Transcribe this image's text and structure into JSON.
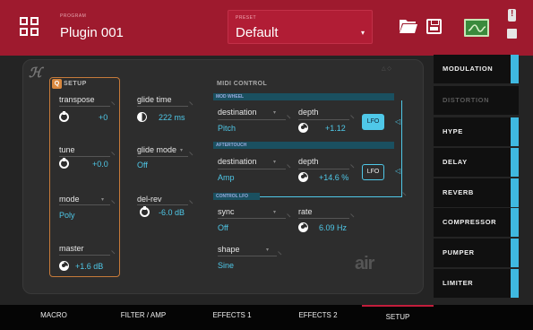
{
  "header": {
    "program_label": "PROGRAM",
    "program_name": "Plugin 001",
    "preset_label": "PRESET",
    "preset_value": "Default"
  },
  "setup": {
    "title": "SETUP",
    "badge": "Q",
    "transpose": {
      "label": "transpose",
      "value": "+0"
    },
    "tune": {
      "label": "tune",
      "value": "+0.0"
    },
    "mode": {
      "label": "mode",
      "value": "Poly"
    },
    "master": {
      "label": "master",
      "value": "+1.6 dB"
    },
    "glide_time": {
      "label": "glide time",
      "value": "222 ms"
    },
    "glide_mode": {
      "label": "glide mode",
      "value": "Off"
    },
    "del_rev": {
      "label": "del-rev",
      "value": "-6.0 dB"
    }
  },
  "midi": {
    "title": "MIDI CONTROL",
    "mod_wheel": {
      "section": "MOD WHEEL",
      "destination_label": "destination",
      "destination_value": "Pitch",
      "depth_label": "depth",
      "depth_value": "+1.12",
      "lfo": "LFO"
    },
    "aftertouch": {
      "section": "AFTERTOUCH",
      "destination_label": "destination",
      "destination_value": "Amp",
      "depth_label": "depth",
      "depth_value": "+14.6 %",
      "lfo": "LFO"
    },
    "control_lfo": {
      "section": "CONTROL LFO",
      "sync_label": "sync",
      "sync_value": "Off",
      "rate_label": "rate",
      "rate_value": "6.09 Hz",
      "shape_label": "shape",
      "shape_value": "Sine"
    }
  },
  "logo": "air",
  "sidebar": {
    "items": [
      {
        "label": "MODULATION",
        "enabled": true
      },
      {
        "label": "DISTORTION",
        "enabled": false
      },
      {
        "label": "HYPE",
        "enabled": true
      },
      {
        "label": "DELAY",
        "enabled": true
      },
      {
        "label": "REVERB",
        "enabled": true
      },
      {
        "label": "COMPRESSOR",
        "enabled": true
      },
      {
        "label": "PUMPER",
        "enabled": true
      },
      {
        "label": "LIMITER",
        "enabled": true
      }
    ]
  },
  "tabs": [
    {
      "label": "MACRO",
      "active": false
    },
    {
      "label": "FILTER / AMP",
      "active": false
    },
    {
      "label": "EFFECTS 1",
      "active": false
    },
    {
      "label": "EFFECTS 2",
      "active": false
    },
    {
      "label": "SETUP",
      "active": true
    }
  ],
  "colors": {
    "header": "#9e1a2e",
    "accent": "#4fc8e8",
    "setup_border": "#c67a3a",
    "tab_active": "#c21d3b"
  },
  "icons": [
    "grid-icon",
    "folder-icon",
    "save-icon",
    "waveform-icon",
    "alert-icon",
    "chip-icon"
  ]
}
